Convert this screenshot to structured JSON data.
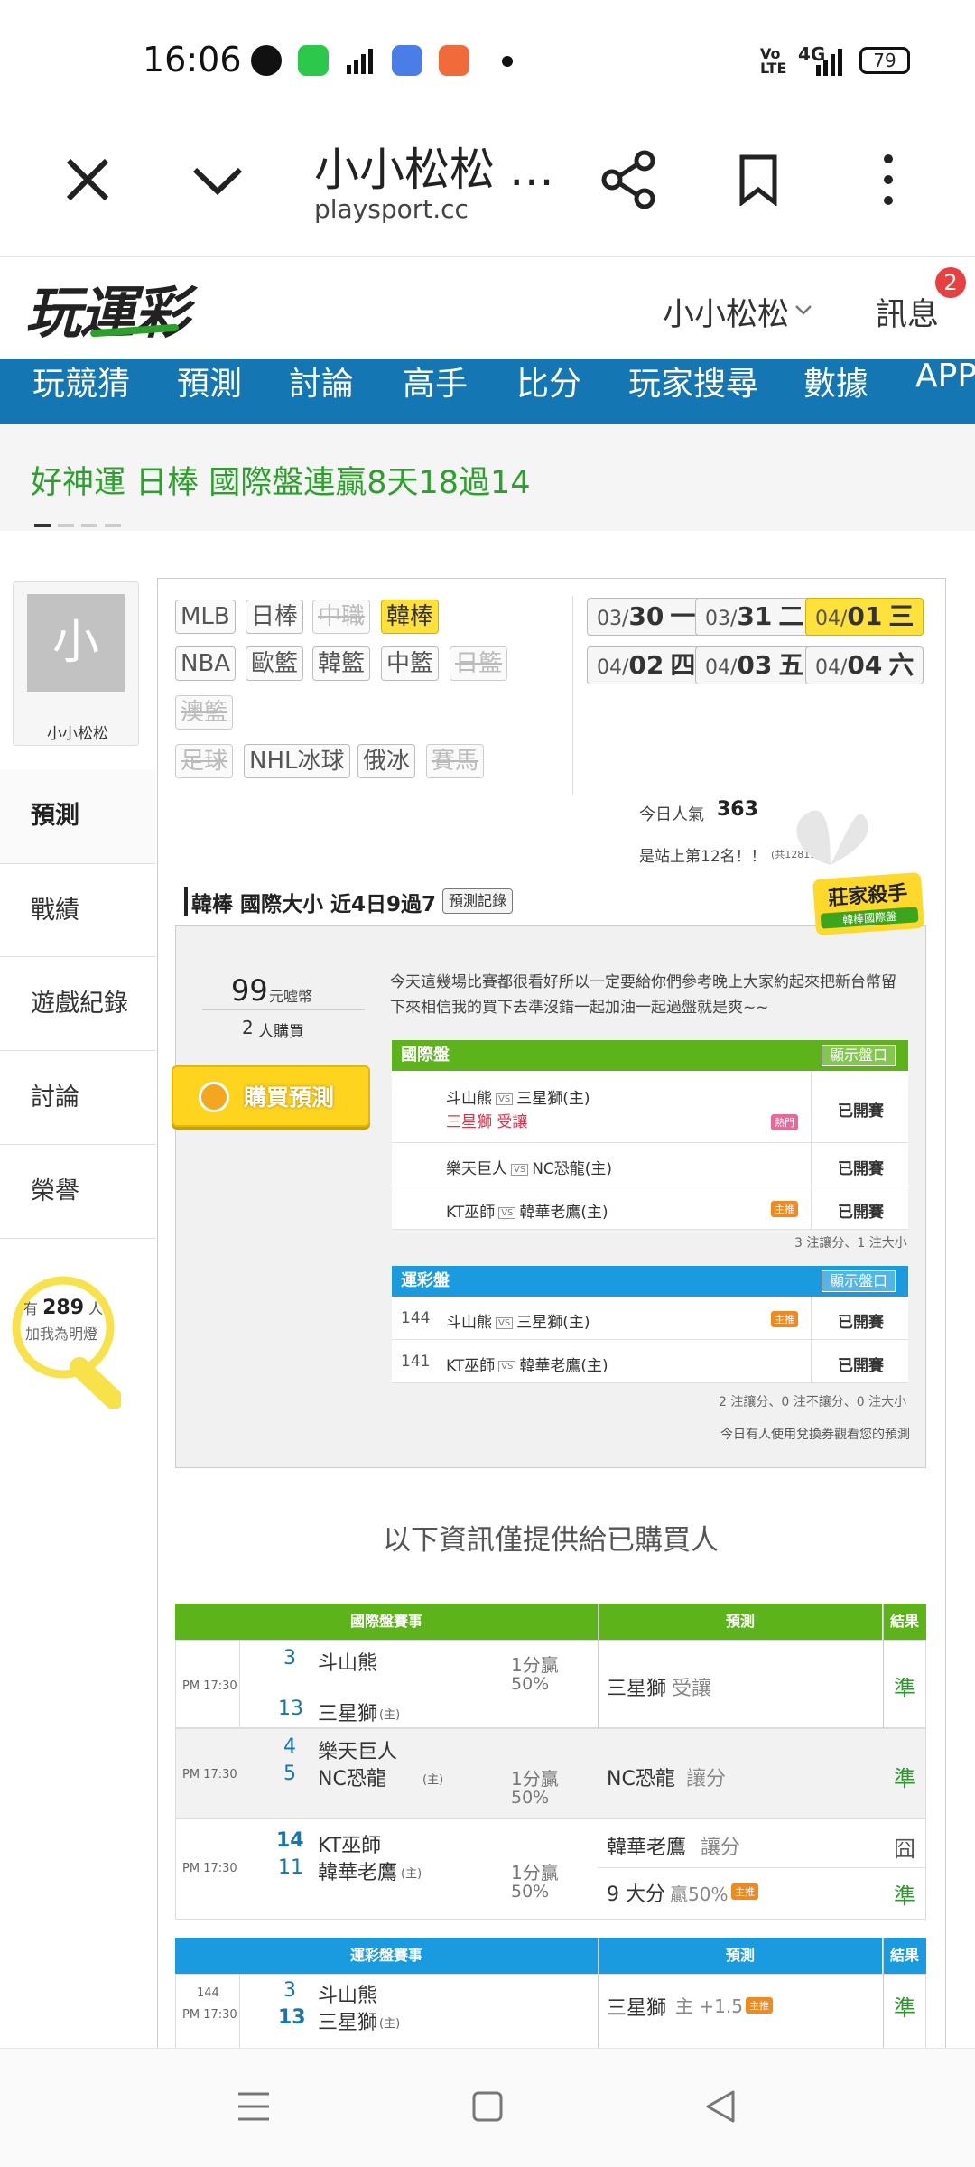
{
  "status": {
    "time": "16:06",
    "battery": "79",
    "net": "4G"
  },
  "browser": {
    "title": "小小松松 …",
    "url": "playsport.cc"
  },
  "site": {
    "logo": "玩運彩",
    "user": "小小松松",
    "messages": "訊息",
    "msg_count": "2"
  },
  "nav": [
    "玩競猜",
    "預測",
    "討論",
    "高手",
    "比分",
    "玩家搜尋",
    "數據",
    "APP"
  ],
  "promo": "好神運 日棒 國際盤連贏8天18過14",
  "profile": {
    "avatar_char": "小",
    "name": "小小松松"
  },
  "sidebar": [
    "預測",
    "戰績",
    "遊戲紀錄",
    "討論",
    "榮譽"
  ],
  "fans": {
    "prefix": "有",
    "count": "289",
    "suffix": "人",
    "sub": "加我為明燈"
  },
  "sports_tags": [
    "MLB",
    "日棒",
    "中職",
    "韓棒",
    "NBA",
    "歐籃",
    "韓籃",
    "中籃",
    "日籃",
    "澳籃",
    "足球",
    "NHL冰球",
    "俄冰",
    "賽馬"
  ],
  "dates": [
    {
      "m": "03/",
      "d": "30",
      "w": "一"
    },
    {
      "m": "03/",
      "d": "31",
      "w": "二"
    },
    {
      "m": "04/",
      "d": "01",
      "w": "三"
    },
    {
      "m": "04/",
      "d": "02",
      "w": "四"
    },
    {
      "m": "04/",
      "d": "03",
      "w": "五"
    },
    {
      "m": "04/",
      "d": "04",
      "w": "六"
    }
  ],
  "popularity": {
    "label": "今日人氣",
    "value": "363",
    "rank": "是站上第12名！！",
    "rank_note": "(共12819人)"
  },
  "pick": {
    "title": "韓棒 國際大小 近4日9過7",
    "record_btn": "預測記錄",
    "killer": "莊家殺手",
    "killer_sub": "韓棒國際盤",
    "price": "99",
    "price_unit": "元嘘幣",
    "buyers": "2",
    "buyers_unit": "人購買",
    "buy_btn": "購買預測",
    "message": "今天這幾場比賽都很看好所以一定要給你們參考晚上大家約起來把新台幣留下來相信我的買下去準沒錯一起加油一起過盤就是爽~~"
  },
  "intl": {
    "header": "國際盤",
    "show_btn": "顯示盤口",
    "rows": [
      {
        "away": "斗山熊",
        "home": "三星獅(主)",
        "sub": "三星獅 受讓",
        "badge": "熱門",
        "status": "已開賽"
      },
      {
        "away": "樂天巨人",
        "home": "NC恐龍(主)",
        "status": "已開賽"
      },
      {
        "away": "KT巫師",
        "home": "韓華老鷹(主)",
        "badge": "主推",
        "status": "已開賽"
      }
    ],
    "summary": "3 注讓分、1 注大小"
  },
  "sport": {
    "header": "運彩盤",
    "show_btn": "顯示盤口",
    "rows": [
      {
        "num": "144",
        "away": "斗山熊",
        "home": "三星獅(主)",
        "badge": "主推",
        "status": "已開賽"
      },
      {
        "num": "141",
        "away": "KT巫師",
        "home": "韓華老鷹(主)",
        "status": "已開賽"
      }
    ],
    "summary": "2 注讓分、0 注不讓分、0 注大小"
  },
  "voucher_note": "今日有人使用兌換券觀看您的預測",
  "buyer_note": "以下資訊僅提供給已購買人",
  "res_intl": {
    "h1": "國際盤賽事",
    "h2": "預測",
    "h3": "結果",
    "games": [
      {
        "time": "PM 17:30",
        "s1": "3",
        "t1": "斗山熊",
        "s2": "13",
        "t2": "三星獅",
        "line": "1分贏",
        "pct": "50%",
        "pick": "三星獅",
        "pick_sub": "受讓",
        "res": "準"
      },
      {
        "time": "PM 17:30",
        "s1": "4",
        "t1": "樂天巨人",
        "s2": "5",
        "t2": "NC恐龍",
        "line": "1分贏",
        "pct": "50%",
        "pick": "NC恐龍",
        "pick_sub": "讓分",
        "res": "準"
      },
      {
        "time": "PM 17:30",
        "s1": "14",
        "t1": "KT巫師",
        "s2": "11",
        "t2": "韓華老鷹",
        "line": "1分贏",
        "pct": "50%",
        "pick": "韓華老鷹",
        "pick_sub": "讓分",
        "res": "囧",
        "pick2": "9 大分",
        "pick2_sub": "贏50%",
        "res2": "準"
      }
    ]
  },
  "res_sport": {
    "h1": "運彩盤賽事",
    "h2": "預測",
    "h3": "結果",
    "games": [
      {
        "num": "144",
        "time": "PM 17:30",
        "s1": "3",
        "t1": "斗山熊",
        "s2": "13",
        "t2": "三星獅",
        "pick": "三星獅",
        "pick_sub": "主 +1.5",
        "res": "準"
      }
    ]
  },
  "home_mark": "(主)",
  "badge_main": "主推",
  "colors": {
    "nav": "#1476b2",
    "green": "#5cb31a",
    "blue": "#1a9be0",
    "yellow": "#ffe13c",
    "win": "#2a9a2a"
  }
}
